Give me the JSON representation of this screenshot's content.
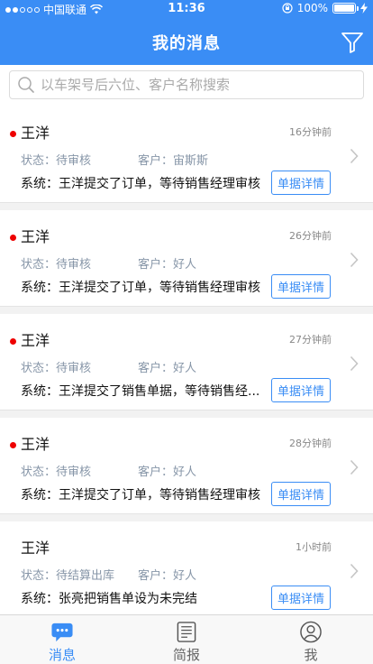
{
  "status_bar": {
    "carrier": "中国联通",
    "time": "11:36",
    "battery": "100%",
    "battery_level": 1.0
  },
  "header": {
    "title": "我的消息",
    "filter_icon": "filter-icon"
  },
  "search": {
    "placeholder": "以车架号后六位、客户名称搜索"
  },
  "messages": [
    {
      "name": "王洋",
      "unread": true,
      "time": "16分钟前",
      "status": "状态：待审核",
      "customer": "客户：宙斯斯",
      "system": "系统：王洋提交了订单，等待销售经理审核",
      "detail_label": "单据详情"
    },
    {
      "name": "王洋",
      "unread": true,
      "time": "26分钟前",
      "status": "状态：待审核",
      "customer": "客户：好人",
      "system": "系统：王洋提交了订单，等待销售经理审核",
      "detail_label": "单据详情"
    },
    {
      "name": "王洋",
      "unread": true,
      "time": "27分钟前",
      "status": "状态：待审核",
      "customer": "客户：好人",
      "system": "系统：王洋提交了销售单据，等待销售经...",
      "detail_label": "单据详情"
    },
    {
      "name": "王洋",
      "unread": true,
      "time": "28分钟前",
      "status": "状态：待审核",
      "customer": "客户：好人",
      "system": "系统：王洋提交了订单，等待销售经理审核",
      "detail_label": "单据详情"
    },
    {
      "name": "王洋",
      "unread": false,
      "time": "1小时前",
      "status": "状态：待结算出库",
      "customer": "客户：好人",
      "system": "系统：张亮把销售单设为未完结",
      "detail_label": "单据详情"
    }
  ],
  "tabs": [
    {
      "label": "消息",
      "icon": "message-icon",
      "active": true
    },
    {
      "label": "简报",
      "icon": "report-icon",
      "active": false
    },
    {
      "label": "我",
      "icon": "profile-icon",
      "active": false
    }
  ],
  "colors": {
    "accent": "#3a8df5",
    "unread": "#e00000",
    "status_text": "#8796a8"
  }
}
